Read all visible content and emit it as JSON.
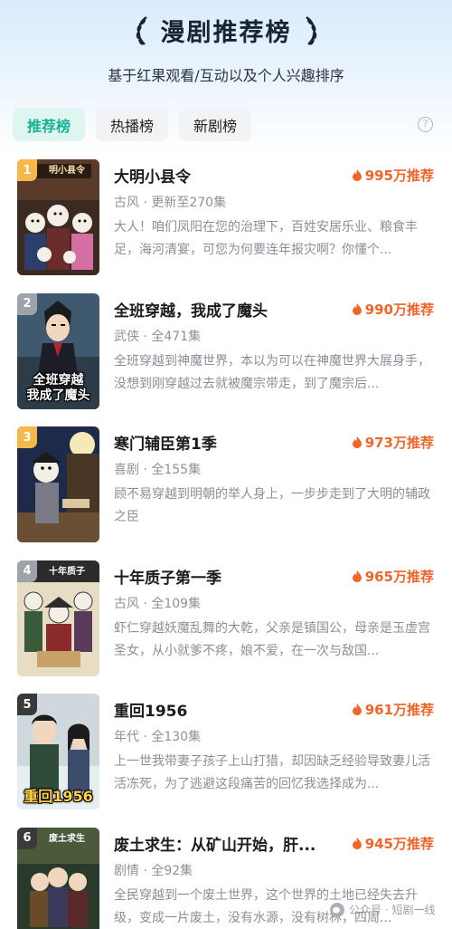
{
  "header": {
    "title": "漫剧推荐榜",
    "subtitle": "基于红果观看/互动以及个人兴趣排序"
  },
  "tabs": [
    {
      "label": "推荐榜",
      "active": true
    },
    {
      "label": "热播榜",
      "active": false
    },
    {
      "label": "新剧榜",
      "active": false
    }
  ],
  "help_icon": "question-circle-icon",
  "colors": {
    "accent": "#17b197",
    "heat": "#f0652a",
    "rank_top": "#f7b84b",
    "rank_default": "#9ea3aa"
  },
  "items": [
    {
      "rank": "1",
      "name": "大明小县令",
      "heat": "995万推荐",
      "meta": "古风 · 更新至270集",
      "desc": "大人！咱们凤阳在您的治理下，百姓安居乐业、粮食丰足，海河清宴，可您为何要连年报灾啊？你懂个...",
      "cover_top": "明小县令",
      "cover_text": ""
    },
    {
      "rank": "2",
      "name": "全班穿越，我成了魔头",
      "heat": "990万推荐",
      "meta": "武侠 · 全471集",
      "desc": "全班穿越到神魔世界，本以为可以在神魔世界大展身手，没想到刚穿越过去就被魔宗带走，到了魔宗后...",
      "cover_top": "",
      "cover_text": "全班穿越\n我成了魔头"
    },
    {
      "rank": "3",
      "name": "寒门辅臣第1季",
      "heat": "973万推荐",
      "meta": "喜剧 · 全155集",
      "desc": "顾不易穿越到明朝的举人身上，一步步走到了大明的辅政之臣",
      "cover_top": "",
      "cover_text": ""
    },
    {
      "rank": "4",
      "name": "十年质子第一季",
      "heat": "965万推荐",
      "meta": "古风 · 全109集",
      "desc": "虾仁穿越妖魔乱舞的大乾，父亲是镇国公，母亲是玉虚宫圣女，从小就爹不疼，娘不爱，在一次与敌国...",
      "cover_top": "十年质子",
      "cover_text": ""
    },
    {
      "rank": "5",
      "name": "重回1956",
      "heat": "961万推荐",
      "meta": "年代 · 全130集",
      "desc": "上一世我带妻子孩子上山打猎，却因缺乏经验导致妻儿活活冻死，为了逃避这段痛苦的回忆我选择成为...",
      "cover_top": "",
      "cover_text": "重回1956"
    },
    {
      "rank": "6",
      "name": "废土求生：从矿山开始，肝...",
      "heat": "945万推荐",
      "meta": "剧情 · 全92集",
      "desc": "全民穿越到一个废土世界，这个世界的土地已经失去升级，变成一片废土，没有水源，没有树林，四周...",
      "cover_top": "废土求生",
      "cover_text": ""
    }
  ],
  "watermark": "公众号 · 短剧一线"
}
